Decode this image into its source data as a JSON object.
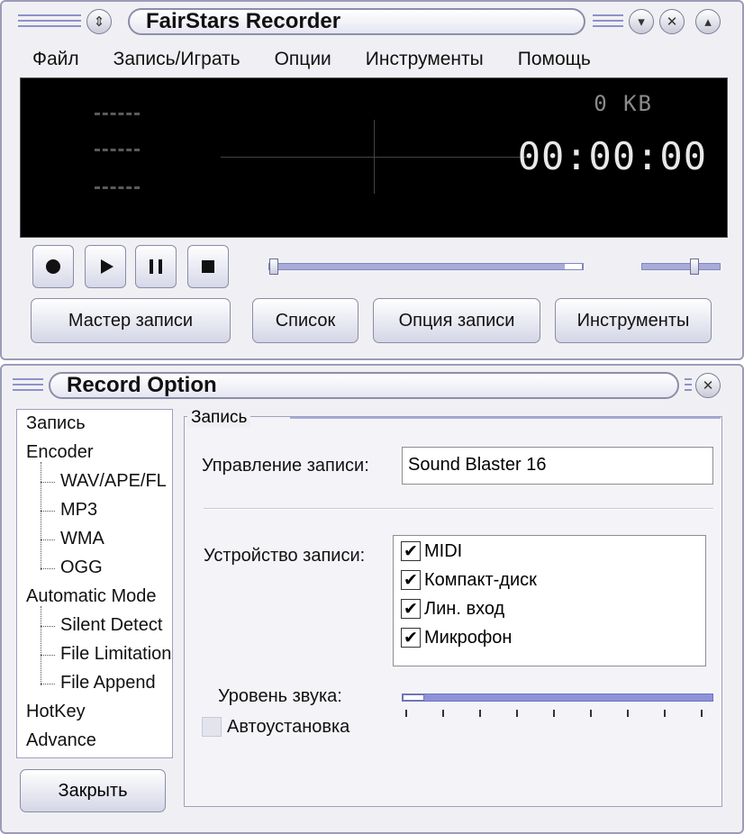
{
  "main": {
    "title": "FairStars Recorder",
    "menu": [
      "Файл",
      "Запись/Играть",
      "Опции",
      "Инструменты",
      "Помощь"
    ],
    "display": {
      "size": "0 KB",
      "time": "00:00:00"
    },
    "controls": {
      "icons": [
        "record-icon",
        "play-icon",
        "pause-icon",
        "stop-icon"
      ],
      "position_fraction": 0.0,
      "volume_fraction": 0.7
    },
    "buttons": {
      "wizard": "Мастер записи",
      "list": "Список",
      "record_option": "Опция записи",
      "tools": "Инструменты"
    }
  },
  "options": {
    "title": "Record Option",
    "tree": {
      "item0": "Запись",
      "item1": "Encoder",
      "item2": "WAV/APE/FL",
      "item3": "MP3",
      "item4": "WMA",
      "item5": "OGG",
      "item6": "Automatic Mode",
      "item7": "Silent Detect",
      "item8": "File Limitation",
      "item9": "File Append",
      "item10": "HotKey",
      "item11": "Advance"
    },
    "close": "Закрыть",
    "group_label": "Запись",
    "record_control_label": "Управление записи:",
    "record_control_value": "Sound Blaster 16",
    "record_device_label": "Устройство записи:",
    "devices": [
      {
        "label": "MIDI",
        "checked": true
      },
      {
        "label": "Компакт-диск",
        "checked": true
      },
      {
        "label": "Лин. вход",
        "checked": true
      },
      {
        "label": "Микрофон",
        "checked": true
      }
    ],
    "volume_label": "Уровень звука:",
    "volume_fraction": 0.0,
    "auto_label": "Автоустановка",
    "auto_checked": false
  },
  "colors": {
    "window_bg": "#f0f0f4",
    "accent": "#8e92d8",
    "display_bg": "#000000"
  }
}
